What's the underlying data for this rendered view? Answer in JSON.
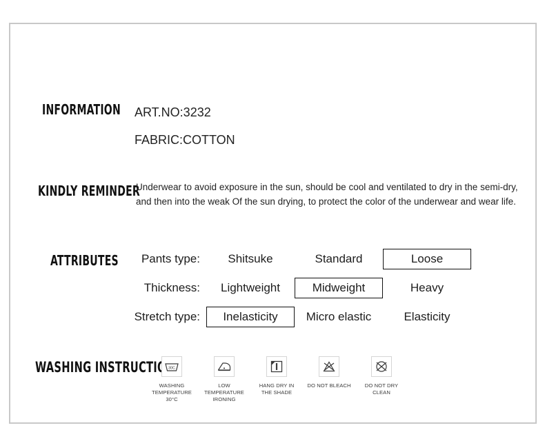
{
  "information": {
    "label": "INFORMATION",
    "lines": [
      "ART.NO:3232",
      "FABRIC:COTTON"
    ]
  },
  "reminder": {
    "label": "KINDLY REMINDER",
    "lines": [
      "Underwear to avoid exposure in the sun, should be cool and ventilated to dry in the semi-dry,",
      "and then into the weak Of the sun drying, to protect the color of the underwear and wear life."
    ]
  },
  "attributes": {
    "label": "ATTRIBUTES",
    "rows": [
      {
        "label": "Pants type:",
        "options": [
          {
            "text": "Shitsuke",
            "selected": false
          },
          {
            "text": "Standard",
            "selected": false
          },
          {
            "text": "Loose",
            "selected": true
          }
        ]
      },
      {
        "label": "Thickness:",
        "options": [
          {
            "text": "Lightweight",
            "selected": false
          },
          {
            "text": "Midweight",
            "selected": true
          },
          {
            "text": "Heavy",
            "selected": false
          }
        ]
      },
      {
        "label": "Stretch type:",
        "options": [
          {
            "text": "Inelasticity",
            "selected": true
          },
          {
            "text": "Micro elastic",
            "selected": false
          },
          {
            "text": "Elasticity",
            "selected": false
          }
        ]
      }
    ]
  },
  "washing": {
    "label": "WASHING INSTRUCTION",
    "icons": [
      {
        "icon": "wash-tub-30c-icon",
        "caption": "WASHING\nTEMPERATURE 30°C"
      },
      {
        "icon": "low-temperature-iron-icon",
        "caption": "LOW TEMPERATURE\nIRONING"
      },
      {
        "icon": "hang-dry-in-shade-icon",
        "caption": "HANG DRY IN\nTHE SHADE"
      },
      {
        "icon": "do-not-bleach-icon",
        "caption": "DO NOT BLEACH"
      },
      {
        "icon": "do-not-dry-clean-icon",
        "caption": "DO NOT DRY\nCLEAN"
      }
    ],
    "tub_temp_text": "30C"
  },
  "colors": {
    "border": "#c8c8c8",
    "text": "#1a1a1a",
    "box_border": "#111111"
  }
}
